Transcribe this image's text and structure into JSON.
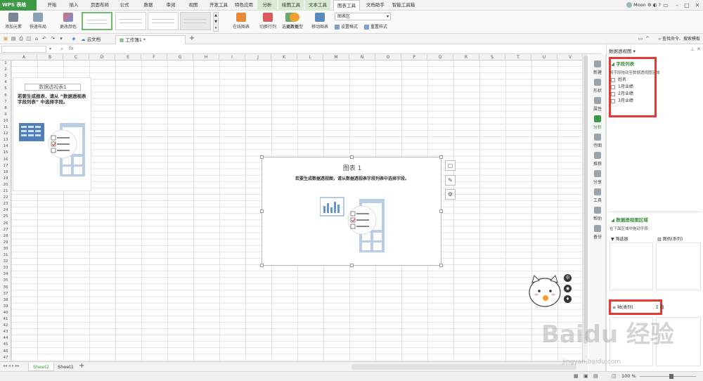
{
  "app": {
    "name": "WPS 表格"
  },
  "menu": {
    "items": [
      "开始",
      "插入",
      "页面布局",
      "公式",
      "数据",
      "审阅",
      "视图",
      "开发工具",
      "特色应用",
      "分析",
      "绘图工具",
      "文本工具",
      "图表工具",
      "文档助手",
      "智能工具箱"
    ],
    "active": "图表工具",
    "user": "Moon"
  },
  "ribbon": {
    "add_element": "添加元素",
    "quick_layout": "快速布局",
    "change_color": "更改颜色",
    "online_chart": "在线图表",
    "switch_row_col": "切换行列",
    "select_data": "选择数据",
    "change_type": "更改类型",
    "move_chart": "移动图表",
    "chart_area_select": "图表区",
    "set_format": "设置格式",
    "reset_style": "重置样式"
  },
  "search": {
    "label": "查找命令、搜索模板"
  },
  "tabs": {
    "cloud": "云文档",
    "workbook": "工作簿1 *"
  },
  "formula": {
    "fx": "fx"
  },
  "columns": [
    "A",
    "B",
    "C",
    "D",
    "E",
    "F",
    "G",
    "H",
    "I",
    "J",
    "K",
    "L",
    "M",
    "N",
    "O",
    "P",
    "Q",
    "R",
    "S",
    "T",
    "U",
    "V"
  ],
  "rows": [
    "1",
    "2",
    "3",
    "4",
    "5",
    "6",
    "7",
    "8",
    "9",
    "10",
    "11",
    "12",
    "13",
    "14",
    "15",
    "16",
    "17",
    "18",
    "19",
    "20",
    "21",
    "22",
    "23",
    "24",
    "25",
    "26",
    "27",
    "28",
    "29",
    "30",
    "31",
    "32",
    "33",
    "34",
    "35",
    "36",
    "37",
    "38",
    "39",
    "40",
    "41",
    "42",
    "43",
    "44",
    "45",
    "46",
    "47"
  ],
  "pivot_table": {
    "title": "数据透视表1",
    "hint": "若要生成报表，请从 “数据透视表字段列表” 中选择字段。"
  },
  "chart": {
    "title": "图表 1",
    "hint": "若要生成数据透视图，请从数据透视表字段列表中选择字段。"
  },
  "sheets": [
    "Sheet2",
    "Sheet1"
  ],
  "active_sheet": "Sheet2",
  "sidebar": [
    "新建",
    "形状",
    "属性",
    "分析",
    "传图",
    "推荐",
    "分享",
    "工具",
    "帮助",
    "备份"
  ],
  "pane": {
    "header": "数据透视图",
    "field_list_title": "字段列表",
    "field_list_hint": "将字段拖动至数据透视图区域",
    "fields": [
      "姓名",
      "1月业绩",
      "2月业绩",
      "3月业绩"
    ],
    "area_title": "数据透视图区域",
    "area_hint": "在下面区域中拖动字段",
    "zones": {
      "filter": "筛选器",
      "legend": "图例(系列)",
      "axis": "轴(类别)",
      "values": "值"
    }
  },
  "status": {
    "zoom": "100 %"
  },
  "watermark": "Baidu 经验",
  "watermark_sub": "jingyan.baidu.com"
}
